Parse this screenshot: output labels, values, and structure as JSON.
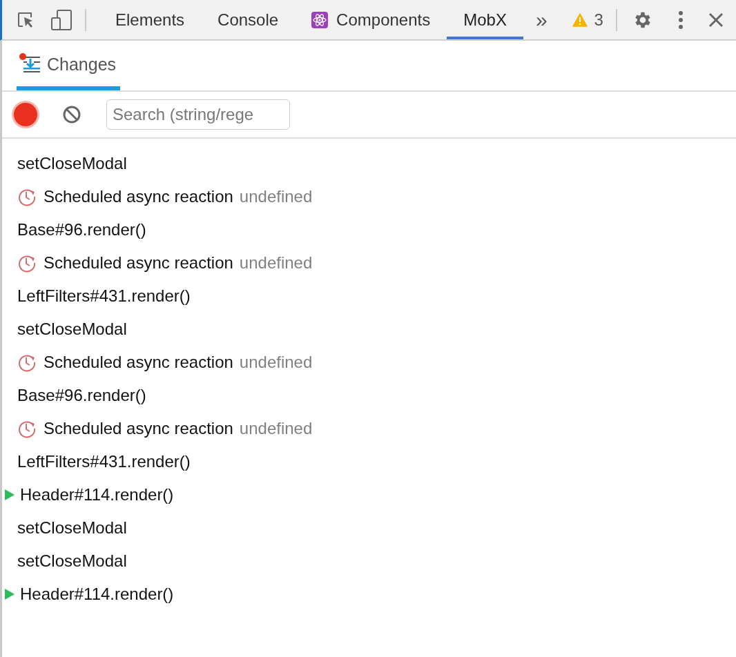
{
  "devtools_tabs": [
    {
      "label": "Elements",
      "selected": false,
      "kind": "builtin"
    },
    {
      "label": "Console",
      "selected": false,
      "kind": "builtin"
    },
    {
      "label": "Components",
      "selected": false,
      "kind": "extension"
    },
    {
      "label": "MobX",
      "selected": true,
      "kind": "builtin"
    }
  ],
  "overflow": "»",
  "warnings": {
    "count": "3"
  },
  "panel_tabs": [
    {
      "label": "Changes",
      "selected": true,
      "badge": true
    }
  ],
  "toolbar": {
    "recording": true,
    "search": {
      "placeholder": "Search (string/rege"
    }
  },
  "log": [
    {
      "kind": "action",
      "text": "setCloseModal"
    },
    {
      "kind": "reaction",
      "text": "Scheduled async reaction",
      "detail": "undefined"
    },
    {
      "kind": "action",
      "text": "Base#96.render()"
    },
    {
      "kind": "reaction",
      "text": "Scheduled async reaction",
      "detail": "undefined"
    },
    {
      "kind": "action",
      "text": "LeftFilters#431.render()"
    },
    {
      "kind": "action",
      "text": "setCloseModal"
    },
    {
      "kind": "reaction",
      "text": "Scheduled async reaction",
      "detail": "undefined"
    },
    {
      "kind": "action",
      "text": "Base#96.render()"
    },
    {
      "kind": "reaction",
      "text": "Scheduled async reaction",
      "detail": "undefined"
    },
    {
      "kind": "action",
      "text": "LeftFilters#431.render()"
    },
    {
      "kind": "group",
      "text": "Header#114.render()",
      "expanded": false
    },
    {
      "kind": "action",
      "text": "setCloseModal"
    },
    {
      "kind": "action",
      "text": "setCloseModal"
    },
    {
      "kind": "group",
      "text": "Header#114.render()",
      "expanded": false
    }
  ]
}
